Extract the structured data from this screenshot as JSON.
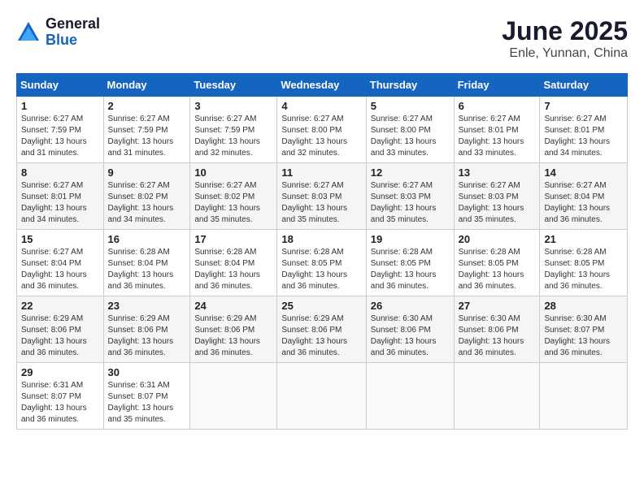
{
  "logo": {
    "general": "General",
    "blue": "Blue"
  },
  "title": "June 2025",
  "subtitle": "Enle, Yunnan, China",
  "days_header": [
    "Sunday",
    "Monday",
    "Tuesday",
    "Wednesday",
    "Thursday",
    "Friday",
    "Saturday"
  ],
  "weeks": [
    [
      {
        "day": "1",
        "sunrise": "6:27 AM",
        "sunset": "7:59 PM",
        "daylight": "13 hours and 31 minutes."
      },
      {
        "day": "2",
        "sunrise": "6:27 AM",
        "sunset": "7:59 PM",
        "daylight": "13 hours and 31 minutes."
      },
      {
        "day": "3",
        "sunrise": "6:27 AM",
        "sunset": "7:59 PM",
        "daylight": "13 hours and 32 minutes."
      },
      {
        "day": "4",
        "sunrise": "6:27 AM",
        "sunset": "8:00 PM",
        "daylight": "13 hours and 32 minutes."
      },
      {
        "day": "5",
        "sunrise": "6:27 AM",
        "sunset": "8:00 PM",
        "daylight": "13 hours and 33 minutes."
      },
      {
        "day": "6",
        "sunrise": "6:27 AM",
        "sunset": "8:01 PM",
        "daylight": "13 hours and 33 minutes."
      },
      {
        "day": "7",
        "sunrise": "6:27 AM",
        "sunset": "8:01 PM",
        "daylight": "13 hours and 34 minutes."
      }
    ],
    [
      {
        "day": "8",
        "sunrise": "6:27 AM",
        "sunset": "8:01 PM",
        "daylight": "13 hours and 34 minutes."
      },
      {
        "day": "9",
        "sunrise": "6:27 AM",
        "sunset": "8:02 PM",
        "daylight": "13 hours and 34 minutes."
      },
      {
        "day": "10",
        "sunrise": "6:27 AM",
        "sunset": "8:02 PM",
        "daylight": "13 hours and 35 minutes."
      },
      {
        "day": "11",
        "sunrise": "6:27 AM",
        "sunset": "8:03 PM",
        "daylight": "13 hours and 35 minutes."
      },
      {
        "day": "12",
        "sunrise": "6:27 AM",
        "sunset": "8:03 PM",
        "daylight": "13 hours and 35 minutes."
      },
      {
        "day": "13",
        "sunrise": "6:27 AM",
        "sunset": "8:03 PM",
        "daylight": "13 hours and 35 minutes."
      },
      {
        "day": "14",
        "sunrise": "6:27 AM",
        "sunset": "8:04 PM",
        "daylight": "13 hours and 36 minutes."
      }
    ],
    [
      {
        "day": "15",
        "sunrise": "6:27 AM",
        "sunset": "8:04 PM",
        "daylight": "13 hours and 36 minutes."
      },
      {
        "day": "16",
        "sunrise": "6:28 AM",
        "sunset": "8:04 PM",
        "daylight": "13 hours and 36 minutes."
      },
      {
        "day": "17",
        "sunrise": "6:28 AM",
        "sunset": "8:04 PM",
        "daylight": "13 hours and 36 minutes."
      },
      {
        "day": "18",
        "sunrise": "6:28 AM",
        "sunset": "8:05 PM",
        "daylight": "13 hours and 36 minutes."
      },
      {
        "day": "19",
        "sunrise": "6:28 AM",
        "sunset": "8:05 PM",
        "daylight": "13 hours and 36 minutes."
      },
      {
        "day": "20",
        "sunrise": "6:28 AM",
        "sunset": "8:05 PM",
        "daylight": "13 hours and 36 minutes."
      },
      {
        "day": "21",
        "sunrise": "6:28 AM",
        "sunset": "8:05 PM",
        "daylight": "13 hours and 36 minutes."
      }
    ],
    [
      {
        "day": "22",
        "sunrise": "6:29 AM",
        "sunset": "8:06 PM",
        "daylight": "13 hours and 36 minutes."
      },
      {
        "day": "23",
        "sunrise": "6:29 AM",
        "sunset": "8:06 PM",
        "daylight": "13 hours and 36 minutes."
      },
      {
        "day": "24",
        "sunrise": "6:29 AM",
        "sunset": "8:06 PM",
        "daylight": "13 hours and 36 minutes."
      },
      {
        "day": "25",
        "sunrise": "6:29 AM",
        "sunset": "8:06 PM",
        "daylight": "13 hours and 36 minutes."
      },
      {
        "day": "26",
        "sunrise": "6:30 AM",
        "sunset": "8:06 PM",
        "daylight": "13 hours and 36 minutes."
      },
      {
        "day": "27",
        "sunrise": "6:30 AM",
        "sunset": "8:06 PM",
        "daylight": "13 hours and 36 minutes."
      },
      {
        "day": "28",
        "sunrise": "6:30 AM",
        "sunset": "8:07 PM",
        "daylight": "13 hours and 36 minutes."
      }
    ],
    [
      {
        "day": "29",
        "sunrise": "6:31 AM",
        "sunset": "8:07 PM",
        "daylight": "13 hours and 36 minutes."
      },
      {
        "day": "30",
        "sunrise": "6:31 AM",
        "sunset": "8:07 PM",
        "daylight": "13 hours and 35 minutes."
      },
      null,
      null,
      null,
      null,
      null
    ]
  ]
}
